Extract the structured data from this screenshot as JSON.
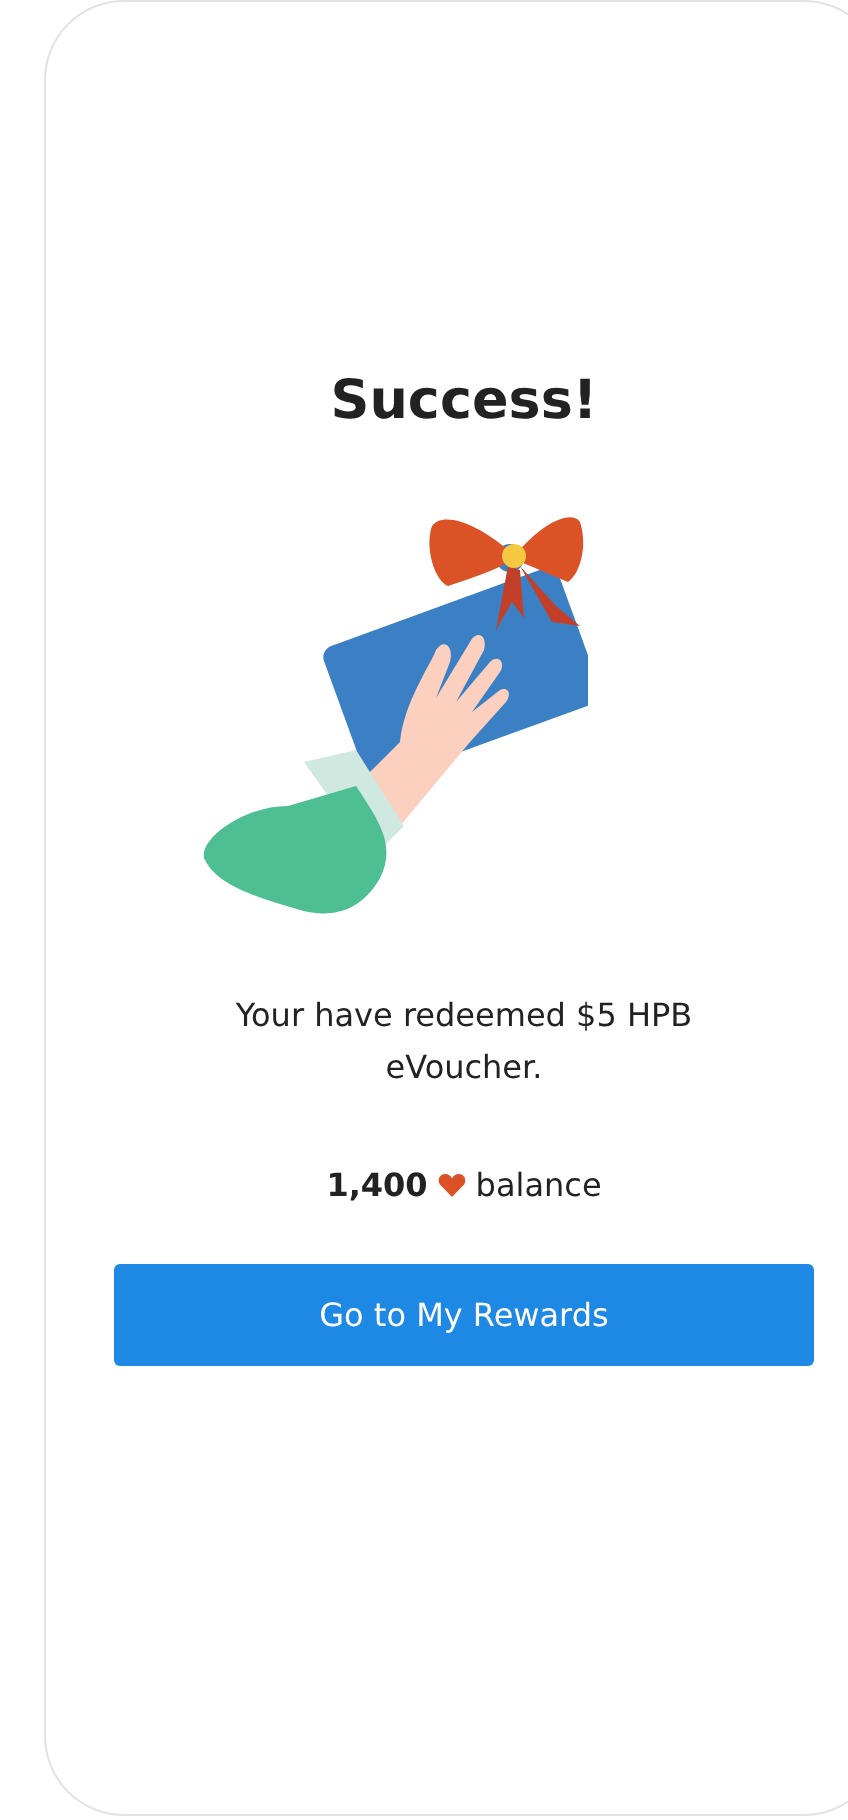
{
  "title": "Success!",
  "message": "Your have redeemed $5 HPB eVoucher.",
  "balance": {
    "amount": "1,400",
    "label": "balance"
  },
  "button": {
    "label": "Go to My Rewards"
  }
}
